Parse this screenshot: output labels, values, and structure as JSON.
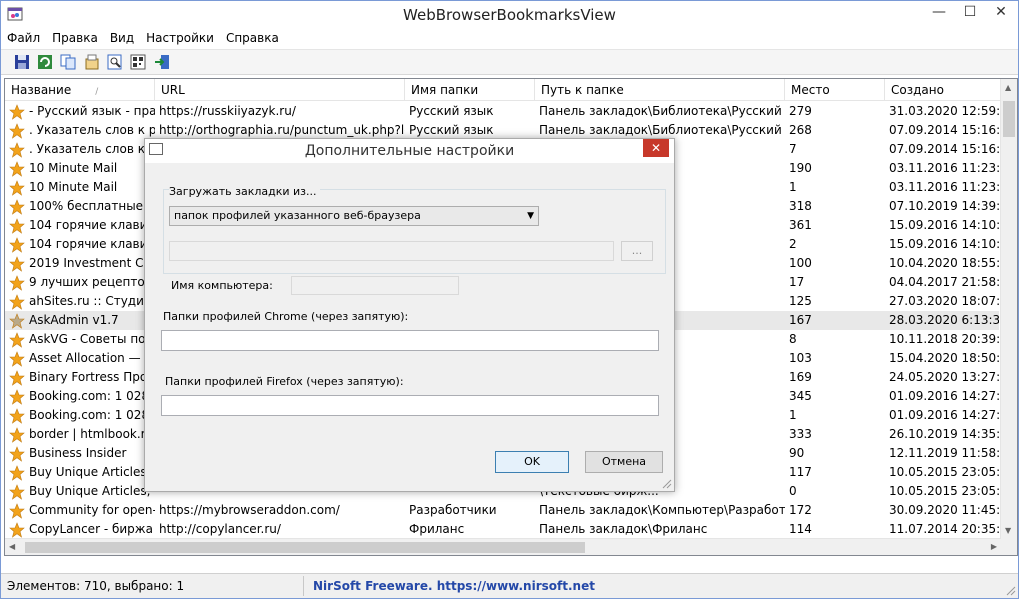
{
  "window": {
    "title": "WebBrowserBookmarksView"
  },
  "menu": [
    "Файл",
    "Правка",
    "Вид",
    "Настройки",
    "Справка"
  ],
  "columns": [
    "Название",
    "URL",
    "Имя папки",
    "Путь к папке",
    "Место",
    "Создано"
  ],
  "rows": [
    [
      "- Русский язык - пра...",
      "https://russkiiyazyk.ru/",
      "Русский язык",
      "Панель закладок\\Библиотека\\Русский яз...",
      "279",
      "31.03.2020 12:59:34"
    ],
    [
      ". Указатель слов к ра...",
      "http://orthographia.ru/punctum_uk.php?le...",
      "Русский язык",
      "Панель закладок\\Библиотека\\Русский яз...",
      "268",
      "07.09.2014 15:16:51"
    ],
    [
      ". Указатель слов к ра",
      "",
      "",
      "\\Русс...",
      "7",
      "07.09.2014 15:16:51"
    ],
    [
      "10 Minute Mail",
      "",
      "",
      "",
      "190",
      "03.11.2016 11:23:38"
    ],
    [
      "10 Minute Mail",
      "",
      "",
      "Сервисы",
      "1",
      "03.11.2016 11:23:38"
    ],
    [
      "100% бесплатные ва",
      "",
      "",
      "Все для Joomla",
      "318",
      "07.10.2019 14:39:19"
    ],
    [
      "104 горячие клавиш...",
      "",
      "",
      "",
      "361",
      "15.09.2016 14:10:28"
    ],
    [
      "104 горячие клавиш...",
      "",
      "",
      "",
      "2",
      "15.09.2016 14:10:28"
    ],
    [
      "2019 Investment Com",
      "",
      "",
      "ирование\\Отчет...",
      "100",
      "10.04.2020 18:55:42"
    ],
    [
      "9 лучших рецептов с",
      "",
      "",
      "",
      "17",
      "04.04.2017 21:58:02"
    ],
    [
      "ahSites.ru :: Студия к",
      "",
      "",
      "нс",
      "125",
      "27.03.2020 18:07:19"
    ],
    [
      "AskAdmin v1.7",
      "",
      "",
      "ютер\\Разработч...",
      "167",
      "28.03.2020 6:13:30"
    ],
    [
      "AskVG - Советы по W",
      "",
      "",
      "Компьютерное\\...",
      "8",
      "10.11.2018 20:39:52"
    ],
    [
      "Asset Allocation — Ф",
      "",
      "",
      "ирование",
      "103",
      "15.04.2020 18:50:09"
    ],
    [
      "Binary Fortress Прогр",
      "",
      "",
      "ютер\\Разработч...",
      "169",
      "24.05.2020 13:27:14"
    ],
    [
      "Booking.com: 1 028 0",
      "",
      "",
      "шествия\\Отели",
      "345",
      "01.09.2016 14:27:39"
    ],
    [
      "Booking.com: 1 028 0",
      "",
      "",
      "Путешествия\\От...",
      "1",
      "01.09.2016 14:27:39"
    ],
    [
      "border | htmlbook.ru",
      "",
      "",
      "HTML CSS",
      "333",
      "26.10.2019 14:35:56"
    ],
    [
      "Business Insider",
      "",
      "",
      "ирование\\Ново...",
      "90",
      "12.11.2019 11:58:47"
    ],
    [
      "Buy Unique Articles, ...",
      "",
      "",
      "нс\\Англоязычны...",
      "117",
      "10.05.2015 23:05:51"
    ],
    [
      "Buy Unique Articles, ...",
      "",
      "",
      "\\Текстовые бирж...",
      "0",
      "10.05.2015 23:05:51"
    ],
    [
      "Community for open-...",
      "https://mybrowseraddon.com/",
      "Разработчики",
      "Панель закладок\\Компьютер\\Разработч...",
      "172",
      "30.09.2020 11:45:56"
    ],
    [
      "CopyLancer - биржа ...",
      "http://copylancer.ru/",
      "Фриланс",
      "Панель закладок\\Фриланс",
      "114",
      "11.07.2014 20:35:24"
    ],
    [
      "CopyLancer - биржа ...",
      "http://copylancer.ru/",
      "Текстовые биржи",
      "menu\\Панель закладок\\Текстовые биржи",
      "4",
      "11.07.2014 20:35:24"
    ]
  ],
  "status": {
    "count": "Элементов: 710, выбрано: 1",
    "brand": "NirSoft Freeware. https://www.nirsoft.net"
  },
  "dialog": {
    "title": "Дополнительные настройки",
    "load_label": "Загружать закладки из...",
    "load_select": "папок профилей указанного веб-браузера",
    "browse_button": "...",
    "computer_label": "Имя компьютера:",
    "chrome_label": "Папки профилей Chrome (через запятую):",
    "firefox_label": "Папки профилей Firefox (через запятую):",
    "ok": "OK",
    "cancel": "Отмена"
  },
  "colors": {
    "star": "#f2a31b",
    "close": "#c7382a",
    "brand_text": "#2448a8"
  }
}
